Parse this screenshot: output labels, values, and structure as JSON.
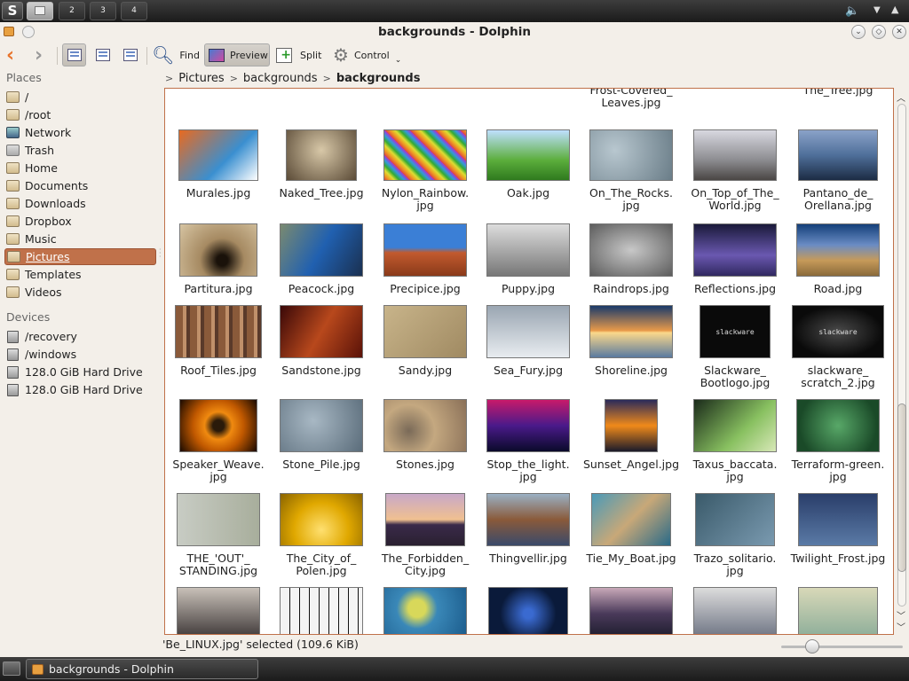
{
  "panel": {
    "menu_label": "S",
    "desktops": [
      "",
      "2",
      "3",
      "4"
    ],
    "volume_icon": "speaker-icon"
  },
  "window": {
    "title": "backgrounds - Dolphin"
  },
  "toolbar": {
    "find": "Find",
    "preview": "Preview",
    "split": "Split",
    "control": "Control"
  },
  "places": {
    "places_heading": "Places",
    "items": [
      "/",
      "/root",
      "Network",
      "Trash",
      "Home",
      "Documents",
      "Downloads",
      "Dropbox",
      "Music",
      "Pictures",
      "Templates",
      "Videos"
    ],
    "selected": "Pictures",
    "devices_heading": "Devices",
    "devices": [
      "/recovery",
      "/windows",
      "128.0 GiB Hard Drive",
      "128.0 GiB Hard Drive"
    ]
  },
  "breadcrumb": {
    "items": [
      "Pictures",
      "backgrounds",
      "backgrounds"
    ]
  },
  "files": {
    "top_row": [
      "Frost-Covered_ Leaves.jpg",
      "The_Tree.jpg"
    ],
    "rows": [
      [
        "Murales.jpg",
        "Naked_Tree.jpg",
        "Nylon_Rainbow. jpg",
        "Oak.jpg",
        "On_The_Rocks. jpg",
        "On_Top_of_The_ World.jpg",
        "Pantano_de_ Orellana.jpg"
      ],
      [
        "Partitura.jpg",
        "Peacock.jpg",
        "Precipice.jpg",
        "Puppy.jpg",
        "Raindrops.jpg",
        "Reflections.jpg",
        "Road.jpg"
      ],
      [
        "Roof_Tiles.jpg",
        "Sandstone.jpg",
        "Sandy.jpg",
        "Sea_Fury.jpg",
        "Shoreline.jpg",
        "Slackware_ Bootlogo.jpg",
        "slackware_ scratch_2.jpg"
      ],
      [
        "Speaker_Weave. jpg",
        "Stone_Pile.jpg",
        "Stones.jpg",
        "Stop_the_light. jpg",
        "Sunset_Angel.jpg",
        "Taxus_baccata. jpg",
        "Terraform-green. jpg"
      ],
      [
        "THE_'OUT'_ STANDING.jpg",
        "The_City_of_ Polen.jpg",
        "The_Forbidden_ City.jpg",
        "Thingvellir.jpg",
        "Tie_My_Boat.jpg",
        "Trazo_solitario. jpg",
        "Twilight_Frost.jpg"
      ],
      [
        "",
        "",
        "",
        "",
        "",
        "",
        ""
      ]
    ],
    "thumb_text": {
      "Slackware_ Bootlogo.jpg": "slackware",
      "slackware_ scratch_2.jpg": "slackware"
    }
  },
  "status": {
    "text": "'Be_LINUX.jpg' selected (109.6 KiB)"
  },
  "taskbar": {
    "task_label": "backgrounds - Dolphin"
  }
}
